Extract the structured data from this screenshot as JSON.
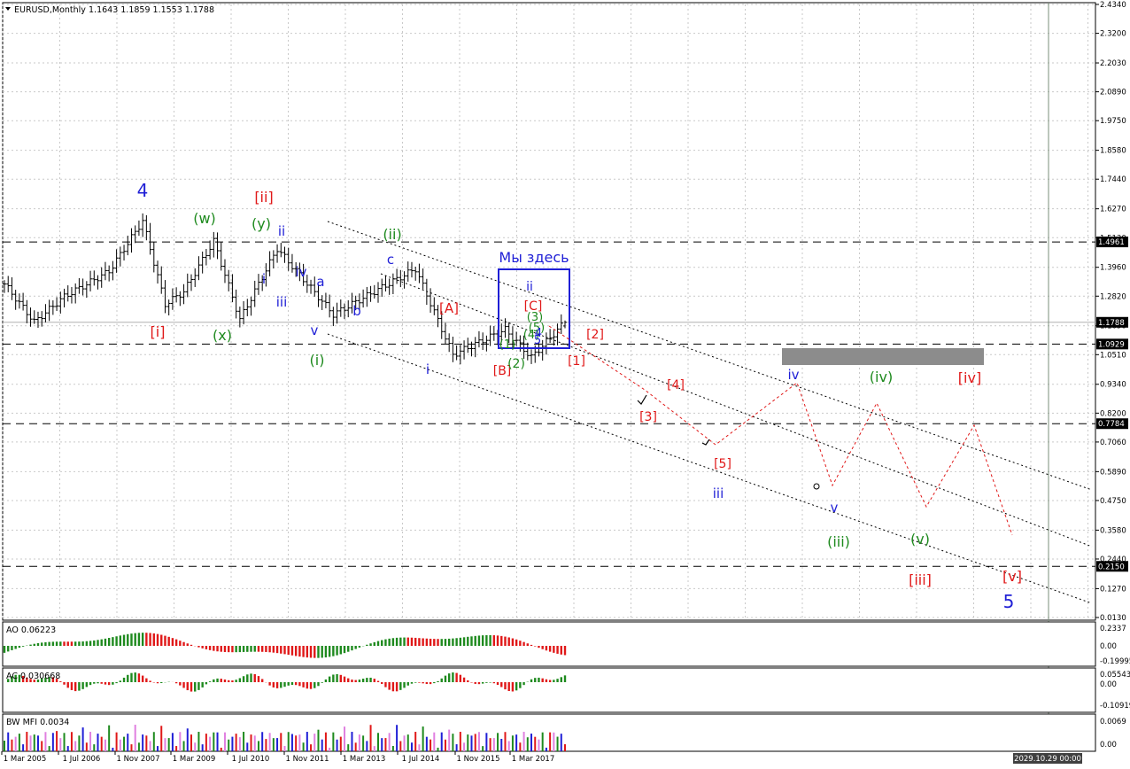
{
  "header": {
    "symbol": "EURUSD,Monthly",
    "ohlc": "1.1643 1.1859 1.1553 1.1788"
  },
  "colors": {
    "blue": "#1f1fd6",
    "green": "#1e8a1e",
    "red": "#e01818",
    "grid": "#c9c9c9",
    "bar": "#000000",
    "zone": "#8c8c8c"
  },
  "main": {
    "y_ticks": [
      "2.4340",
      "2.3200",
      "2.2030",
      "2.0890",
      "1.9750",
      "1.8580",
      "1.7440",
      "1.6270",
      "1.5130",
      "1.3960",
      "1.2820",
      "1.1650",
      "1.0510",
      "0.9340",
      "0.8200",
      "0.7060",
      "0.5890",
      "0.4750",
      "0.3580",
      "0.2440",
      "0.1270",
      "0.0130"
    ],
    "price_labels": [
      "1.4961",
      "1.1788",
      "1.0929",
      "0.7784",
      "0.2150"
    ],
    "annotation": "Мы здесь"
  },
  "x_labels": [
    "1 Mar 2005",
    "1 Jul 2006",
    "1 Nov 2007",
    "1 Mar 2009",
    "1 Jul 2010",
    "1 Nov 2011",
    "1 Mar 2013",
    "1 Jul 2014",
    "1 Nov 2015",
    "1 Mar 2017"
  ],
  "time_label": "2029.10.29 00:00",
  "wave_labels": [
    {
      "t": "4",
      "c": "blue"
    },
    {
      "t": "(w)",
      "c": "green"
    },
    {
      "t": "[ii]",
      "c": "red"
    },
    {
      "t": "(y)",
      "c": "green"
    },
    {
      "t": "ii",
      "c": "blue"
    },
    {
      "t": "(ii)",
      "c": "green"
    },
    {
      "t": "iv",
      "c": "blue"
    },
    {
      "t": "a",
      "c": "blue"
    },
    {
      "t": "c",
      "c": "blue"
    },
    {
      "t": "i",
      "c": "blue"
    },
    {
      "t": "iii",
      "c": "blue"
    },
    {
      "t": "b",
      "c": "blue"
    },
    {
      "t": "[i]",
      "c": "red"
    },
    {
      "t": "(x)",
      "c": "green"
    },
    {
      "t": "v",
      "c": "blue"
    },
    {
      "t": "(i)",
      "c": "green"
    },
    {
      "t": "[A]",
      "c": "red"
    },
    {
      "t": "i",
      "c": "blue"
    },
    {
      "t": "ii",
      "c": "blue"
    },
    {
      "t": "[C]",
      "c": "red"
    },
    {
      "t": "[2]",
      "c": "red"
    },
    {
      "t": "[1]",
      "c": "red"
    },
    {
      "t": "[B]",
      "c": "red"
    },
    {
      "t": "(2)",
      "c": "green"
    },
    {
      "t": "(1)",
      "c": "green"
    },
    {
      "t": "(4)",
      "c": "green"
    },
    {
      "t": "(3)",
      "c": "green"
    },
    {
      "t": "(5)",
      "c": "green"
    },
    {
      "t": "4",
      "c": "blue"
    },
    {
      "t": "5",
      "c": "blue"
    },
    {
      "t": "[4]",
      "c": "red"
    },
    {
      "t": "[3]",
      "c": "red"
    },
    {
      "t": "[5]",
      "c": "red"
    },
    {
      "t": "iii",
      "c": "blue"
    },
    {
      "t": "iv",
      "c": "blue"
    },
    {
      "t": "v",
      "c": "blue"
    },
    {
      "t": "(iv)",
      "c": "green"
    },
    {
      "t": "(iii)",
      "c": "green"
    },
    {
      "t": "(v)",
      "c": "green"
    },
    {
      "t": "[iv]",
      "c": "red"
    },
    {
      "t": "[iii]",
      "c": "red"
    },
    {
      "t": "[v]",
      "c": "red"
    },
    {
      "t": "5",
      "c": "blue"
    }
  ],
  "indicators": {
    "ao": {
      "label": "AO 0.06223",
      "ticks": [
        "0.2337",
        "0.00",
        "-0.19995"
      ]
    },
    "ac": {
      "label": "AC 0.030668",
      "ticks": [
        "0.055436",
        "0.00",
        "-0.10919"
      ]
    },
    "mfi": {
      "label": "BW MFI 0.0034",
      "ticks": [
        "0.0069",
        "0.00"
      ]
    }
  },
  "chart_data": {
    "type": "bar",
    "symbol": "EURUSD",
    "timeframe": "Monthly",
    "last_bar": {
      "open": 1.1643,
      "high": 1.1859,
      "low": 1.1553,
      "close": 1.1788
    },
    "ylim": [
      0.013,
      2.434
    ],
    "horizontal_levels": [
      1.4961,
      1.0929,
      0.7784,
      0.215
    ],
    "current_price": 1.1788,
    "price_path_approx": [
      {
        "date": "2005-03",
        "price": 1.33
      },
      {
        "date": "2005-11",
        "price": 1.18
      },
      {
        "date": "2006-07",
        "price": 1.28
      },
      {
        "date": "2007-07",
        "price": 1.38
      },
      {
        "date": "2008-04",
        "price": 1.58
      },
      {
        "date": "2008-10",
        "price": 1.25
      },
      {
        "date": "2009-03",
        "price": 1.3
      },
      {
        "date": "2009-11",
        "price": 1.5
      },
      {
        "date": "2010-06",
        "price": 1.19
      },
      {
        "date": "2011-04",
        "price": 1.47
      },
      {
        "date": "2012-07",
        "price": 1.21
      },
      {
        "date": "2014-05",
        "price": 1.39
      },
      {
        "date": "2015-03",
        "price": 1.05
      },
      {
        "date": "2016-05",
        "price": 1.15
      },
      {
        "date": "2016-12",
        "price": 1.04
      },
      {
        "date": "2017-09",
        "price": 1.18
      }
    ],
    "projection_path": [
      0.98,
      0.86,
      0.7,
      0.92,
      0.55,
      0.87,
      0.44,
      0.77,
      0.33
    ]
  }
}
